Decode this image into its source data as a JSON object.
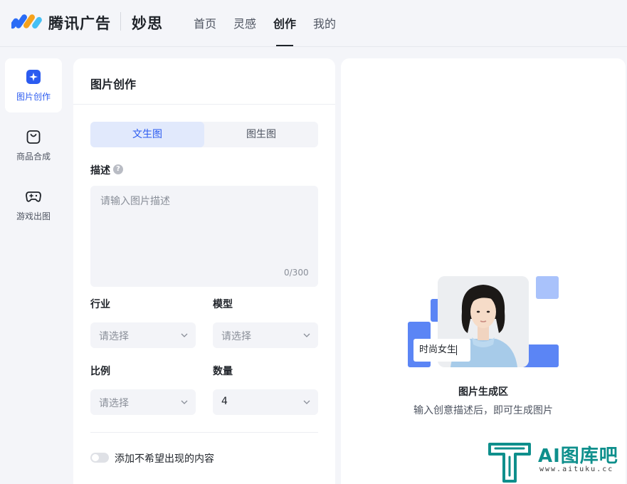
{
  "header": {
    "brand": "腾讯广告",
    "product": "妙思",
    "nav": [
      {
        "label": "首页"
      },
      {
        "label": "灵感"
      },
      {
        "label": "创作",
        "active": true
      },
      {
        "label": "我的"
      }
    ]
  },
  "rail": {
    "items": [
      {
        "label": "图片创作",
        "icon": "sparkle-icon",
        "active": true
      },
      {
        "label": "商品合成",
        "icon": "shopping-bag-icon"
      },
      {
        "label": "游戏出图",
        "icon": "gamepad-icon"
      }
    ]
  },
  "form": {
    "title": "图片创作",
    "mode_tabs": [
      {
        "label": "文生图",
        "selected": true
      },
      {
        "label": "图生图"
      }
    ],
    "description_label": "描述",
    "description_placeholder": "请输入图片描述",
    "description_counter": "0/300",
    "industry_label": "行业",
    "industry_value": "请选择",
    "model_label": "模型",
    "model_value": "请选择",
    "ratio_label": "比例",
    "ratio_value": "请选择",
    "count_label": "数量",
    "count_value": "4",
    "negative_toggle_label": "添加不希望出现的内容",
    "negative_toggle_on": false
  },
  "preview": {
    "sample_input": "时尚女生",
    "title": "图片生成区",
    "subtitle": "输入创意描述后，即可生成图片"
  },
  "watermark": {
    "text": "AI图库吧",
    "sub": "www.aituku.cc"
  },
  "colors": {
    "accent": "#2b5bf0",
    "accent_light": "#e1e9fc",
    "illustration_blue": "#5b85f5",
    "background": "#f4f5f9",
    "watermark": "#0e8f8c"
  }
}
